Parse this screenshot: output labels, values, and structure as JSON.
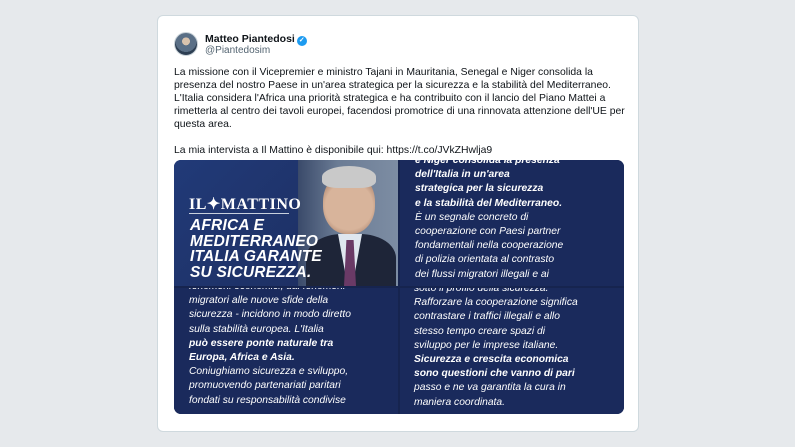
{
  "tweet": {
    "author_name": "Matteo Piantedosi",
    "author_handle": "@Piantedosim",
    "verified_icon": "verified-badge-icon",
    "verified_mark": "✓",
    "paragraph_1": [
      "La missione con il Vicepremier e ministro Tajani in Mauritania, Senegal e Niger consolida la",
      "presenza del nostro Paese in un'area strategica per la sicurezza e la stabilità del Mediterraneo.",
      "L'Italia considera l'Africa una priorità strategica e ha contribuito con il lancio del Piano Mattei a",
      "rimetterla al centro dei tavoli europei, facendosi promotrice di una rinnovata attenzione dell'UE per",
      "questa area."
    ],
    "paragraph_2": "La mia intervista a Il Mattino è disponibile qui: https://t.co/JVkZHwljа9"
  },
  "media": {
    "newspaper_logo": "IL✦MATTINO",
    "headline": [
      "AFRICA E",
      "MEDITERRANEO",
      "ITALIA GARANTE",
      "SU SICUREZZA."
    ],
    "panel_top_right": [
      {
        "text": "e Niger consolida la presenza",
        "bold": true
      },
      {
        "text": "dell'Italia in un'area",
        "bold": true
      },
      {
        "text": "strategica per la sicurezza",
        "bold": true
      },
      {
        "text": "e la stabilità del Mediterraneo.",
        "bold": true
      },
      {
        "text": "È un segnale concreto di",
        "bold": false
      },
      {
        "text": "cooperazione con Paesi partner",
        "bold": false
      },
      {
        "text": "fondamentali nella cooperazione",
        "bold": false
      },
      {
        "text": "di polizia orientata al contrasto",
        "bold": false
      },
      {
        "text": "dei flussi migratori illegali e ai",
        "bold": false
      }
    ],
    "panel_bottom_left": [
      {
        "text": "fenomeni economici, dai fenomeni",
        "bold": false
      },
      {
        "text": "migratori alle nuove sfide della",
        "bold": false
      },
      {
        "text": "sicurezza - incidono in modo diretto",
        "bold": false
      },
      {
        "text": "sulla stabilità europea. L'Italia",
        "bold": false
      },
      {
        "text": "può essere ponte naturale tra",
        "bold": true
      },
      {
        "text": "Europa, Africa e Asia.",
        "bold": true
      },
      {
        "text": "Coniughiamo sicurezza e sviluppo,",
        "bold": false
      },
      {
        "text": "promuovendo partenariati paritari",
        "bold": false
      },
      {
        "text": "fondati su responsabilità condivise",
        "bold": false
      }
    ],
    "panel_bottom_right": [
      {
        "text": "sotto il profilo della sicurezza.",
        "bold": false
      },
      {
        "text": "Rafforzare la cooperazione significa",
        "bold": false
      },
      {
        "text": "contrastare i traffici illegali e allo",
        "bold": false
      },
      {
        "text": "stesso tempo creare spazi di",
        "bold": false
      },
      {
        "text": "sviluppo per le imprese italiane.",
        "bold": false
      },
      {
        "text": "Sicurezza e crescita economica",
        "bold": true
      },
      {
        "text": "sono questioni che vanno di pari",
        "bold": true
      },
      {
        "text": "passo e ne va garantita la cura in",
        "bold": false
      },
      {
        "text": "maniera coordinata.",
        "bold": false
      }
    ]
  },
  "colors": {
    "page_bg": "#e6e9ec",
    "card_bg": "#ffffff",
    "panel_bg": "#1a2a5c",
    "verified_blue": "#1d9bf0"
  }
}
